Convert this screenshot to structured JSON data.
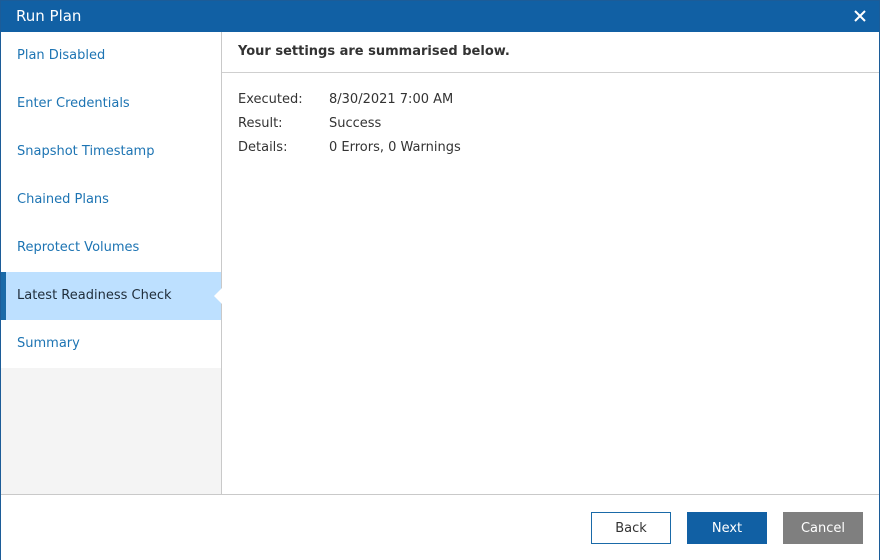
{
  "window": {
    "title": "Run Plan",
    "close_icon": "close-icon"
  },
  "sidebar": {
    "items": [
      {
        "label": "Plan Disabled",
        "active": false
      },
      {
        "label": "Enter Credentials",
        "active": false
      },
      {
        "label": "Snapshot Timestamp",
        "active": false
      },
      {
        "label": "Chained Plans",
        "active": false
      },
      {
        "label": "Reprotect Volumes",
        "active": false
      },
      {
        "label": "Latest Readiness Check",
        "active": true
      },
      {
        "label": "Summary",
        "active": false
      }
    ]
  },
  "main": {
    "header": "Your settings are summarised below.",
    "summary": [
      {
        "key": "Executed:",
        "value": "8/30/2021 7:00 AM"
      },
      {
        "key": "Result:",
        "value": "Success"
      },
      {
        "key": "Details:",
        "value": "0 Errors, 0 Warnings"
      }
    ]
  },
  "footer": {
    "back": "Back",
    "next": "Next",
    "cancel": "Cancel"
  },
  "colors": {
    "titlebar": "#1160a4",
    "active_nav": "#bde0ff",
    "link": "#1d74b3",
    "cancel": "#7f7f7f"
  }
}
